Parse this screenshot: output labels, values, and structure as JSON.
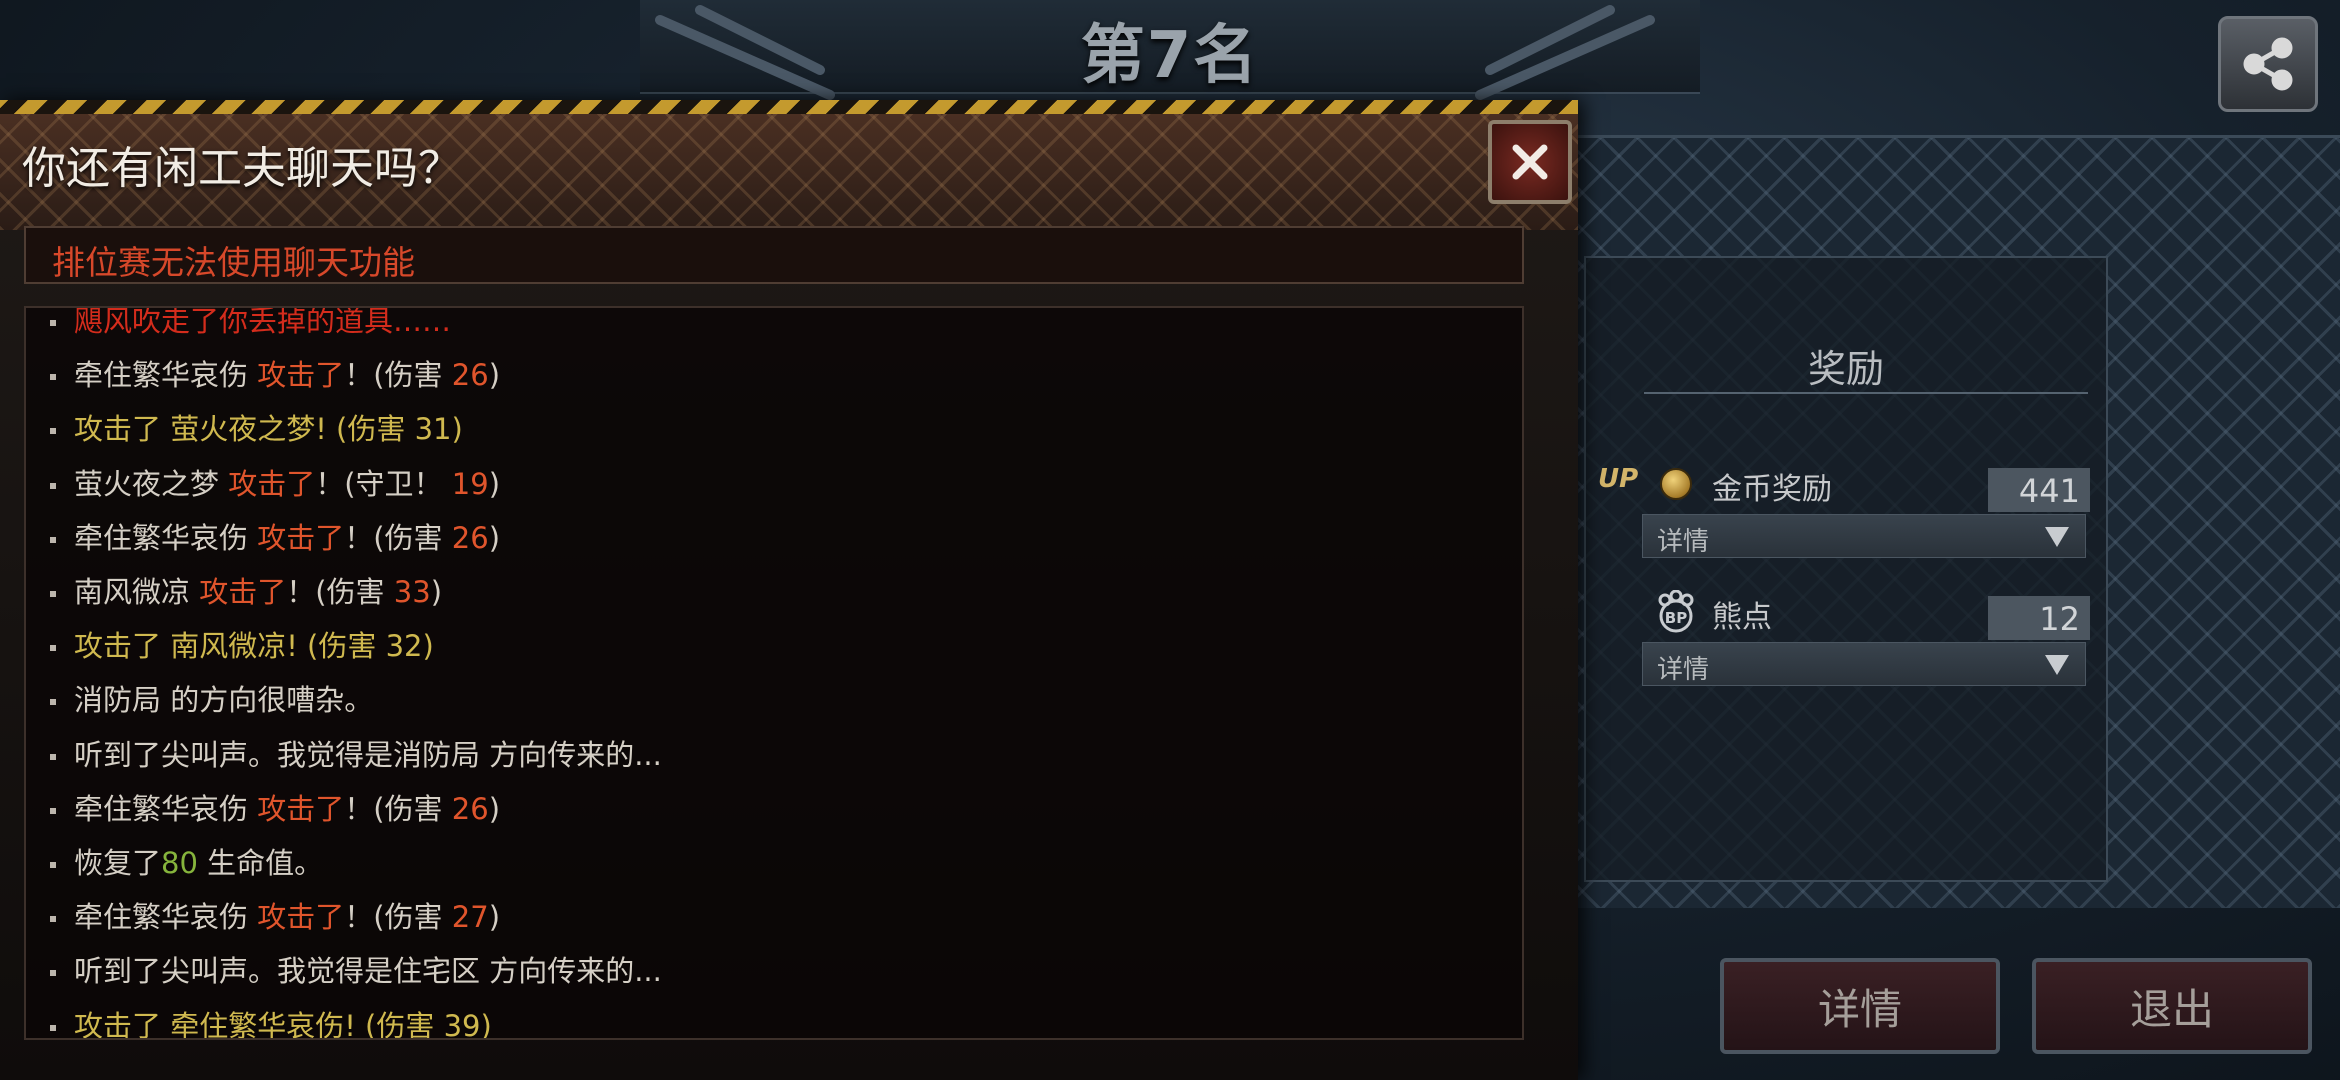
{
  "rank": {
    "title": "第7名"
  },
  "share_button": {
    "icon": "share-icon"
  },
  "reward_panel": {
    "title": "奖励",
    "items": [
      {
        "badge": "UP",
        "icon": "coin-icon",
        "label": "金币奖励",
        "value": "441",
        "detail_label": "详情"
      },
      {
        "icon": "bear-points-icon",
        "label": "熊点",
        "value": "12",
        "detail_label": "详情"
      }
    ]
  },
  "buttons": {
    "details": "详情",
    "exit": "退出"
  },
  "dialog": {
    "title": "你还有闲工夫聊天吗？",
    "notice": "排位赛无法使用聊天功能",
    "log": [
      {
        "parts": [
          {
            "t": "飓风吹走了你丢掉的道具……",
            "c": "warn"
          }
        ]
      },
      {
        "parts": [
          {
            "t": "牵住繁华哀伤",
            "c": "name"
          },
          {
            "t": "  攻击了",
            "c": "att"
          },
          {
            "t": "！(伤害 ",
            "c": "plain"
          },
          {
            "t": "26",
            "c": "red"
          },
          {
            "t": ")",
            "c": "plain"
          }
        ]
      },
      {
        "parts": [
          {
            "t": "攻击了 萤火夜之梦! (伤害 ",
            "c": "yellow"
          },
          {
            "t": "31",
            "c": "yellow"
          },
          {
            "t": ")",
            "c": "yellow"
          }
        ]
      },
      {
        "parts": [
          {
            "t": "萤火夜之梦",
            "c": "name"
          },
          {
            "t": "  攻击了",
            "c": "att"
          },
          {
            "t": "！(守卫！ ",
            "c": "plain"
          },
          {
            "t": "19",
            "c": "red"
          },
          {
            "t": ")",
            "c": "plain"
          }
        ]
      },
      {
        "parts": [
          {
            "t": "牵住繁华哀伤",
            "c": "name"
          },
          {
            "t": "  攻击了",
            "c": "att"
          },
          {
            "t": "！(伤害 ",
            "c": "plain"
          },
          {
            "t": "26",
            "c": "red"
          },
          {
            "t": ")",
            "c": "plain"
          }
        ]
      },
      {
        "parts": [
          {
            "t": "南风微凉",
            "c": "name"
          },
          {
            "t": "  攻击了",
            "c": "att"
          },
          {
            "t": "！(伤害 ",
            "c": "plain"
          },
          {
            "t": "33",
            "c": "red"
          },
          {
            "t": ")",
            "c": "plain"
          }
        ]
      },
      {
        "parts": [
          {
            "t": "攻击了 南风微凉! (伤害 ",
            "c": "yellow"
          },
          {
            "t": "32",
            "c": "yellow"
          },
          {
            "t": ")",
            "c": "yellow"
          }
        ]
      },
      {
        "parts": [
          {
            "t": "消防局 的方向很嘈杂。",
            "c": "plain"
          }
        ]
      },
      {
        "parts": [
          {
            "t": "听到了尖叫声。我觉得是消防局 方向传来的...",
            "c": "plain"
          }
        ]
      },
      {
        "parts": [
          {
            "t": "牵住繁华哀伤",
            "c": "name"
          },
          {
            "t": "  攻击了",
            "c": "att"
          },
          {
            "t": "！(伤害 ",
            "c": "plain"
          },
          {
            "t": "26",
            "c": "red"
          },
          {
            "t": ")",
            "c": "plain"
          }
        ]
      },
      {
        "parts": [
          {
            "t": "恢复了",
            "c": "plain"
          },
          {
            "t": "80",
            "c": "green"
          },
          {
            "t": " 生命值。",
            "c": "plain"
          }
        ]
      },
      {
        "parts": [
          {
            "t": "牵住繁华哀伤",
            "c": "name"
          },
          {
            "t": "  攻击了",
            "c": "att"
          },
          {
            "t": "！(伤害 ",
            "c": "plain"
          },
          {
            "t": "27",
            "c": "red"
          },
          {
            "t": ")",
            "c": "plain"
          }
        ]
      },
      {
        "parts": [
          {
            "t": "听到了尖叫声。我觉得是住宅区 方向传来的...",
            "c": "plain"
          }
        ]
      },
      {
        "parts": [
          {
            "t": "攻击了 牵住繁华哀伤! (伤害 ",
            "c": "yellow"
          },
          {
            "t": "39",
            "c": "yellow"
          },
          {
            "t": ")",
            "c": "yellow"
          }
        ]
      }
    ]
  },
  "colors": {
    "accent_red": "#e0552c",
    "notice_red": "#d7482a",
    "yellow_text": "#d0b94f",
    "heal_green": "#86b43c",
    "hazard_gold": "#c49a2e"
  }
}
